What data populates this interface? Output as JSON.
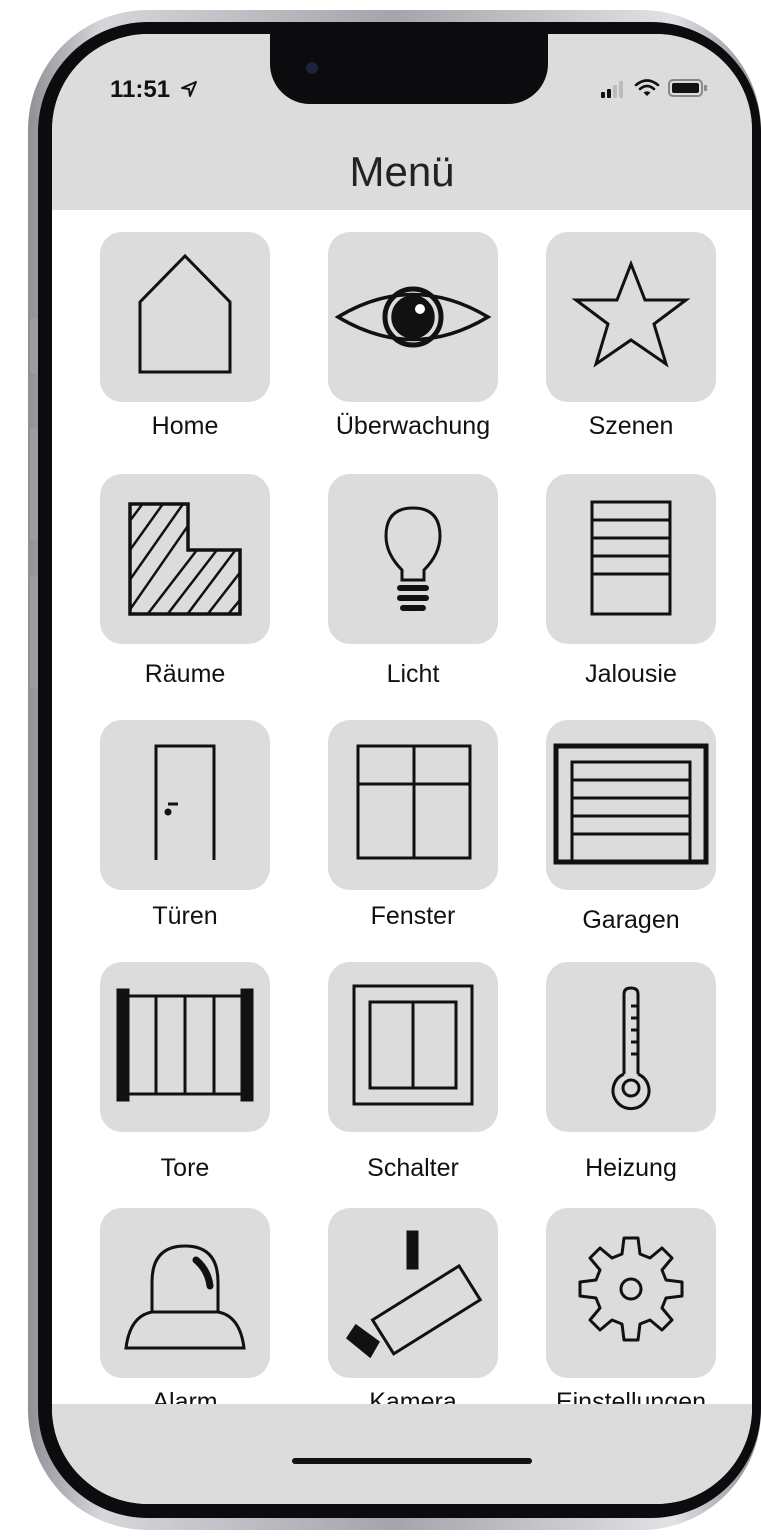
{
  "status_bar": {
    "time": "11:51",
    "icons": [
      "signal-icon",
      "wifi-icon",
      "battery-icon",
      "location-arrow-icon"
    ]
  },
  "header": {
    "title": "Menü"
  },
  "menu": {
    "items": [
      {
        "label": "Home",
        "icon": "house-icon"
      },
      {
        "label": "Überwachung",
        "icon": "eye-icon"
      },
      {
        "label": "Szenen",
        "icon": "star-icon"
      },
      {
        "label": "Räume",
        "icon": "room-icon"
      },
      {
        "label": "Licht",
        "icon": "lightbulb-icon"
      },
      {
        "label": "Jalousie",
        "icon": "blinds-icon"
      },
      {
        "label": "Türen",
        "icon": "door-icon"
      },
      {
        "label": "Fenster",
        "icon": "window-icon"
      },
      {
        "label": "Garagen",
        "icon": "garage-icon"
      },
      {
        "label": "Tore",
        "icon": "gate-icon"
      },
      {
        "label": "Schalter",
        "icon": "switch-icon"
      },
      {
        "label": "Heizung",
        "icon": "thermometer-icon"
      },
      {
        "label": "Alarm",
        "icon": "alarm-light-icon"
      },
      {
        "label": "Kamera",
        "icon": "camera-icon"
      },
      {
        "label": "Einstellungen",
        "icon": "gear-icon"
      }
    ]
  },
  "colors": {
    "tile_background": "#dcdcdc",
    "bar_background": "#dcdcdc",
    "icon_stroke": "#111111",
    "screen_background": "#ffffff"
  }
}
